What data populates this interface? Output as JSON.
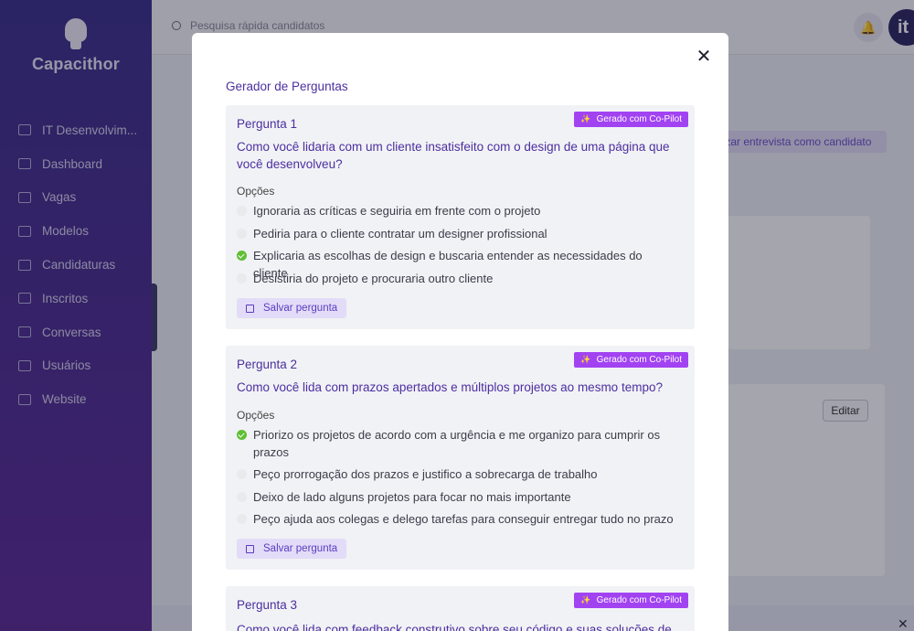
{
  "app": {
    "name": "Capacithor"
  },
  "sidebar": {
    "items": [
      {
        "label": "IT Desenvolvim..."
      },
      {
        "label": "Dashboard"
      },
      {
        "label": "Vagas"
      },
      {
        "label": "Modelos"
      },
      {
        "label": "Candidaturas"
      },
      {
        "label": "Inscritos"
      },
      {
        "label": "Conversas"
      },
      {
        "label": "Usuários"
      },
      {
        "label": "Website"
      }
    ]
  },
  "topbar": {
    "search_placeholder": "Pesquisa rápida candidatos",
    "avatar_text": "it"
  },
  "background": {
    "interview_button": "lizar entrevista como candidato",
    "edit_button": "Editar"
  },
  "modal": {
    "title": "Gerador de Perguntas",
    "badge": "Gerado com Co-Pilot",
    "options_label": "Opções",
    "save_label": "Salvar pergunta",
    "questions": [
      {
        "label": "Pergunta 1",
        "text": "Como você lidaria com um cliente insatisfeito com o design de uma página que você desenvolveu?",
        "options": [
          {
            "text": "Ignoraria as críticas e seguiria em frente com o projeto",
            "selected": false
          },
          {
            "text": "Pediria para o cliente contratar um designer profissional",
            "selected": false
          },
          {
            "text": "Explicaria as escolhas de design e buscaria entender as necessidades do cliente",
            "selected": true
          },
          {
            "text": "Desistiria do projeto e procuraria outro cliente",
            "selected": false
          }
        ]
      },
      {
        "label": "Pergunta 2",
        "text": "Como você lida com prazos apertados e múltiplos projetos ao mesmo tempo?",
        "options": [
          {
            "text": "Priorizo os projetos de acordo com a urgência e me organizo para cumprir os prazos",
            "selected": true
          },
          {
            "text": "Peço prorrogação dos prazos e justifico a sobrecarga de trabalho",
            "selected": false
          },
          {
            "text": "Deixo de lado alguns projetos para focar no mais importante",
            "selected": false
          },
          {
            "text": "Peço ajuda aos colegas e delego tarefas para conseguir entregar tudo no prazo",
            "selected": false
          }
        ]
      },
      {
        "label": "Pergunta 3",
        "text": "Como você lida com feedback construtivo sobre seu código e suas soluções de"
      }
    ]
  }
}
